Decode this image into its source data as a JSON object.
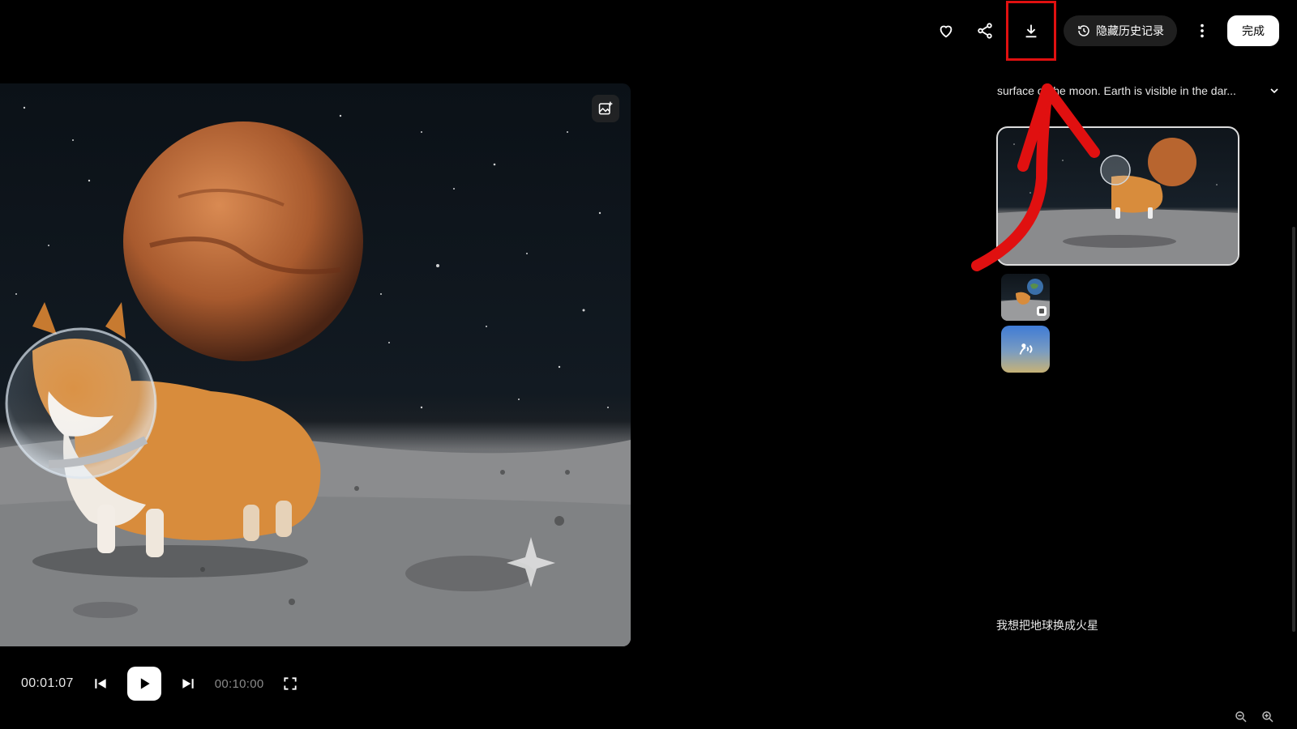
{
  "toolbar": {
    "favorite_icon": "heart-icon",
    "share_icon": "share-icon",
    "download_icon": "download-icon",
    "hide_history_label": "隐藏历史记录",
    "more_icon": "more-vertical-icon",
    "done_label": "完成"
  },
  "player": {
    "current_time": "00:01:07",
    "total_time": "00:10:00"
  },
  "side_panel": {
    "prompt_text": "surface of the moon. Earth is visible in the dar...",
    "user_message": "我想把地球换成火星"
  },
  "annotation": {
    "highlight_color": "#e01010",
    "arrow_color": "#e01010"
  }
}
